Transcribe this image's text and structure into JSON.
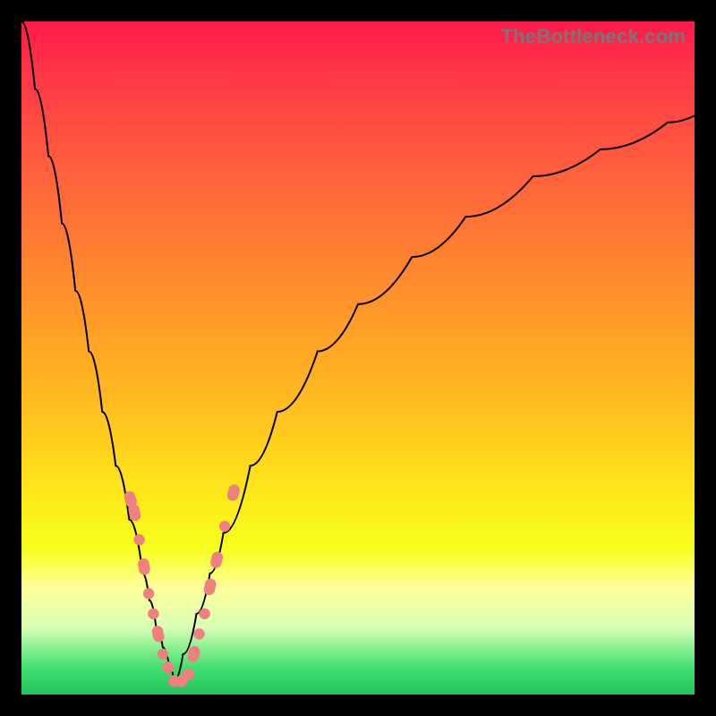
{
  "watermark": "TheBottleneck.com",
  "chart_data": {
    "type": "line",
    "title": "",
    "xlabel": "",
    "ylabel": "",
    "xlim": [
      0,
      100
    ],
    "ylim": [
      0,
      100
    ],
    "grid": false,
    "legend": false,
    "note": "Axes are unlabeled; values estimated from pixel positions on a 0–100 normalized domain. y≈0 at bottom (green) and y≈100 at top (red).",
    "series": [
      {
        "name": "left-branch",
        "x": [
          0,
          2,
          4,
          6,
          8,
          10,
          12,
          14,
          16,
          18,
          19,
          20,
          21,
          22,
          22.7
        ],
        "y": [
          100,
          90,
          80,
          70,
          60,
          51,
          42,
          34,
          26,
          18,
          14,
          10,
          7,
          4,
          2
        ]
      },
      {
        "name": "right-branch",
        "x": [
          22.7,
          24,
          26,
          28,
          30,
          34,
          38,
          44,
          50,
          58,
          66,
          76,
          86,
          96,
          100
        ],
        "y": [
          2,
          6,
          12,
          18,
          24,
          34,
          42,
          51,
          58,
          65,
          71,
          77,
          81,
          85,
          86
        ]
      }
    ],
    "markers": {
      "name": "pink-data",
      "points": [
        {
          "x": 16.2,
          "y": 29
        },
        {
          "x": 16.8,
          "y": 27
        },
        {
          "x": 17.5,
          "y": 23
        },
        {
          "x": 18.2,
          "y": 19
        },
        {
          "x": 18.9,
          "y": 15
        },
        {
          "x": 19.6,
          "y": 12
        },
        {
          "x": 20.3,
          "y": 9
        },
        {
          "x": 21.0,
          "y": 6
        },
        {
          "x": 21.8,
          "y": 4
        },
        {
          "x": 22.7,
          "y": 2
        },
        {
          "x": 23.8,
          "y": 2
        },
        {
          "x": 24.8,
          "y": 3
        },
        {
          "x": 25.6,
          "y": 6
        },
        {
          "x": 26.4,
          "y": 9
        },
        {
          "x": 27.2,
          "y": 12
        },
        {
          "x": 28.0,
          "y": 16
        },
        {
          "x": 29.0,
          "y": 20
        },
        {
          "x": 30.2,
          "y": 25
        },
        {
          "x": 31.5,
          "y": 30
        }
      ]
    },
    "minimum": {
      "x": 22.7,
      "y": 2
    }
  }
}
